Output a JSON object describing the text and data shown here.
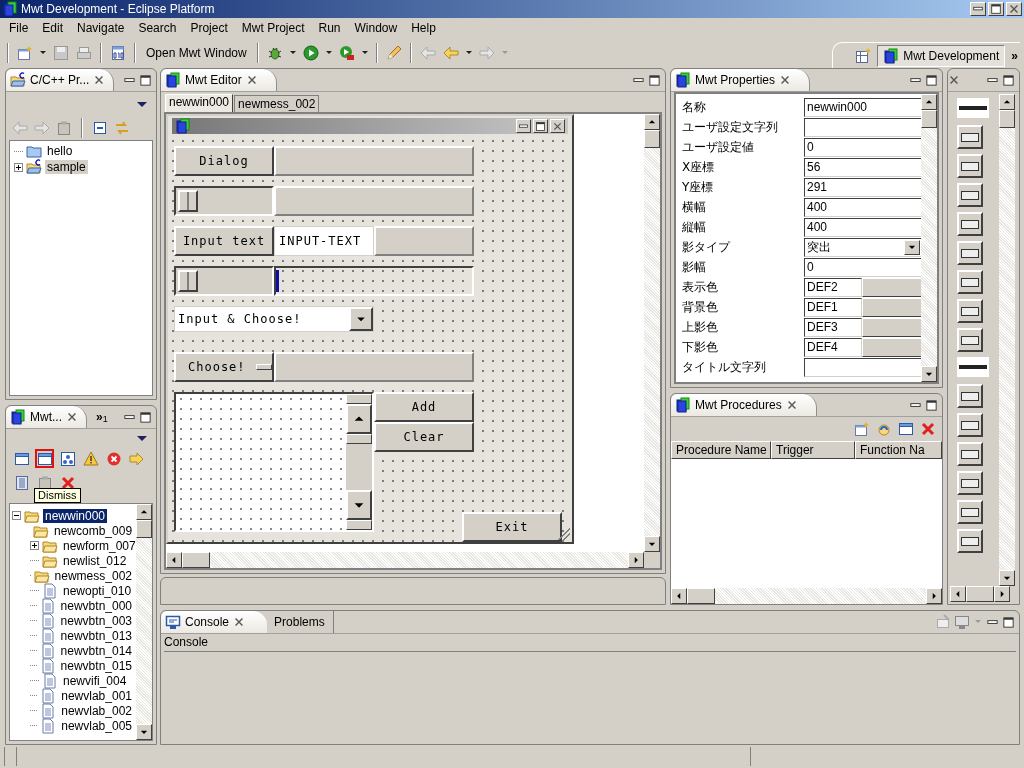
{
  "window": {
    "title": "Mwt Development - Eclipse Platform"
  },
  "menu": [
    "File",
    "Edit",
    "Navigate",
    "Search",
    "Project",
    "Mwt Project",
    "Run",
    "Window",
    "Help"
  ],
  "toolbar": {
    "open_button": "Open Mwt Window"
  },
  "perspective": {
    "label": "Mwt Development",
    "selected": true,
    "more": "»"
  },
  "project_explorer": {
    "tab": "C/C++ Pr...",
    "tree": [
      {
        "label": "hello",
        "kind": "project",
        "selected": false
      },
      {
        "label": "sample",
        "kind": "cproject",
        "selected": true,
        "expanded": false
      }
    ]
  },
  "outline": {
    "tab": "Mwt...",
    "overflow": "»",
    "overflow_count": "1",
    "tooltip": "Dismiss",
    "tools": [
      {
        "kind": "window",
        "highlighted": false
      },
      {
        "kind": "window",
        "highlighted": true
      },
      {
        "kind": "tree",
        "highlighted": false
      },
      {
        "kind": "warning",
        "highlighted": false
      },
      {
        "kind": "error",
        "highlighted": false
      },
      {
        "kind": "arrow",
        "highlighted": false
      },
      {
        "kind": "doc",
        "highlighted": false
      },
      {
        "kind": "paste",
        "highlighted": false
      },
      {
        "kind": "delete",
        "highlighted": false
      }
    ],
    "tree": [
      {
        "label": "newwin000",
        "kind": "folder",
        "selected": true,
        "expanded": true,
        "children": [
          {
            "label": "newcomb_009",
            "kind": "folder",
            "selected": false
          },
          {
            "label": "newform_007",
            "kind": "folder",
            "selected": false,
            "expanded": false
          },
          {
            "label": "newlist_012",
            "kind": "folder",
            "selected": false
          },
          {
            "label": "newmess_002",
            "kind": "folder",
            "selected": false
          },
          {
            "label": "newopti_010",
            "kind": "file",
            "selected": false
          },
          {
            "label": "newvbtn_000",
            "kind": "file",
            "selected": false
          },
          {
            "label": "newvbtn_003",
            "kind": "file",
            "selected": false
          },
          {
            "label": "newvbtn_013",
            "kind": "file",
            "selected": false
          },
          {
            "label": "newvbtn_014",
            "kind": "file",
            "selected": false
          },
          {
            "label": "newvbtn_015",
            "kind": "file",
            "selected": false
          },
          {
            "label": "newvifi_004",
            "kind": "file",
            "selected": false
          },
          {
            "label": "newvlab_001",
            "kind": "file",
            "selected": false
          },
          {
            "label": "newvlab_002",
            "kind": "file",
            "selected": false
          },
          {
            "label": "newvlab_005",
            "kind": "file",
            "selected": false
          }
        ]
      }
    ]
  },
  "editor": {
    "tab": "Mwt Editor",
    "pages": [
      {
        "label": "newwin000",
        "selected": true
      },
      {
        "label": "newmess_002",
        "selected": false
      }
    ],
    "form": {
      "rows": [
        [
          {
            "kind": "button",
            "label": "Dialog"
          },
          {
            "kind": "panel"
          }
        ],
        [
          {
            "kind": "slider"
          },
          {
            "kind": "panel"
          }
        ],
        [
          {
            "kind": "button",
            "label": "Input text"
          },
          {
            "kind": "input",
            "value": "INPUT-TEXT"
          },
          {
            "kind": "panel"
          }
        ],
        [
          {
            "kind": "slider"
          },
          {
            "kind": "gauge"
          }
        ],
        [
          {
            "kind": "combo",
            "value": "Input & Choose!"
          }
        ],
        [
          {
            "kind": "option",
            "label": "Choose!"
          },
          {
            "kind": "panel"
          }
        ],
        [
          {
            "kind": "list"
          },
          {
            "kind": "stack",
            "buttons": [
              "Add",
              "Clear"
            ]
          }
        ]
      ],
      "footer": {
        "kind": "button",
        "label": "Exit"
      }
    }
  },
  "properties": {
    "tab": "Mwt Properties",
    "rows": [
      {
        "label": "名称",
        "kind": "text",
        "value": "newwin000"
      },
      {
        "label": "ユーザ設定文字列",
        "kind": "text"
      },
      {
        "label": "ユーザ設定値",
        "kind": "text",
        "value": "0"
      },
      {
        "label": "X座標",
        "kind": "text",
        "value": "56"
      },
      {
        "label": "Y座標",
        "kind": "text",
        "value": "291"
      },
      {
        "label": "横幅",
        "kind": "text",
        "value": "400"
      },
      {
        "label": "縦幅",
        "kind": "text",
        "value": "400"
      },
      {
        "label": "影タイプ",
        "kind": "select",
        "value": "突出"
      },
      {
        "label": "影幅",
        "kind": "text",
        "value": "0"
      },
      {
        "label": "表示色",
        "kind": "color",
        "value": "DEF2"
      },
      {
        "label": "背景色",
        "kind": "color",
        "value": "DEF1"
      },
      {
        "label": "上影色",
        "kind": "color",
        "value": "DEF3"
      },
      {
        "label": "下影色",
        "kind": "color",
        "value": "DEF4"
      },
      {
        "label": "タイトル文字列",
        "kind": "text"
      }
    ]
  },
  "procedures": {
    "tab": "Mwt Procedures",
    "columns": [
      "Procedure Name",
      "Trigger",
      "Function Na"
    ]
  },
  "console": {
    "tabs": [
      {
        "label": "Console",
        "selected": true
      },
      {
        "label": "Problems",
        "selected": false
      }
    ],
    "heading": "Console"
  }
}
